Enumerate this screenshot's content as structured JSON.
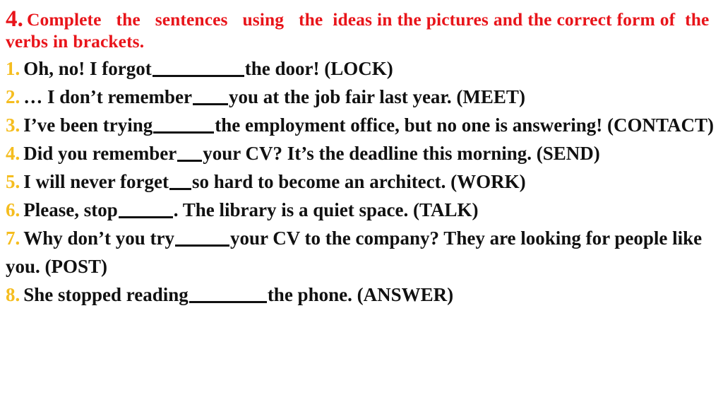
{
  "slide": {
    "background_color": "#ffffff",
    "heading_color": "#e8141a",
    "number_color": "#f5bd1f",
    "body_color": "#111111"
  },
  "task": {
    "number": "4.",
    "instruction_line_1": "Complete   the   sentences   using   the  ideas in the pictures and the correct",
    "instruction_line_2": "form of  the verbs in brackets."
  },
  "exercises": [
    {
      "number": "1.",
      "before": "Oh, no! I forgot",
      "blank_width": 130,
      "after": "the door! (LOCK)"
    },
    {
      "number": "2.",
      "before": "… I don’t remember",
      "blank_width": 50,
      "after": "you at the job fair last year. (MEET)"
    },
    {
      "number": "3.",
      "before": "I’ve been trying",
      "blank_width": 86,
      "after": "the employment office, but no one is answering! (CONTACT)"
    },
    {
      "number": "4.",
      "before": "Did you remember",
      "blank_width": 35,
      "after": "your CV? It’s the deadline this morning. (SEND)"
    },
    {
      "number": "5.",
      "before": "I will never forget",
      "blank_width": 31,
      "after": "so hard to become an architect. (WORK)"
    },
    {
      "number": "6.",
      "before": "Please, stop",
      "blank_width": 77,
      "after": ". The library is a quiet space. (TALK)"
    },
    {
      "number": "7.",
      "before": "Why don’t you try",
      "blank_width": 77,
      "after": "your CV to the company? They are looking for people like you. (POST)"
    },
    {
      "number": "8.",
      "before": "She stopped reading",
      "blank_width": 110,
      "after": "the phone. (ANSWER)"
    }
  ]
}
